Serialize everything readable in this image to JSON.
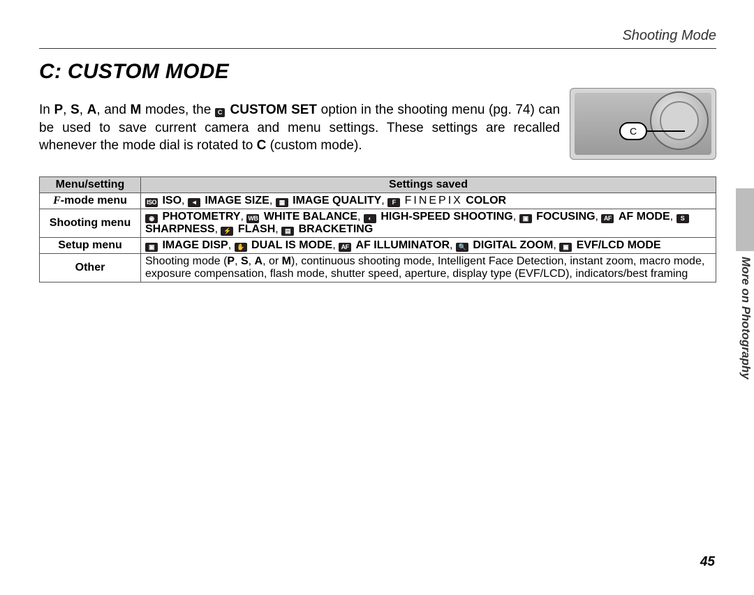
{
  "header": {
    "section": "Shooting Mode"
  },
  "title": "C: CUSTOM MODE",
  "intro": {
    "pre": "In ",
    "modes": [
      "P",
      "S",
      "A",
      "M"
    ],
    "mid": " modes, the ",
    "custom_set": "CUSTOM SET",
    "post1": " option in the shooting menu (pg. 74) can be used to save current camera and menu settings. These settings are recalled whenever the mode dial is rotated to ",
    "c_bold": "C",
    "post2": " (custom mode)."
  },
  "dial": {
    "callout": "C"
  },
  "table": {
    "head": {
      "col1": "Menu/setting",
      "col2": "Settings saved"
    },
    "rows": [
      {
        "label_prefix": "F",
        "label": "-mode menu",
        "items": [
          {
            "icon": "ISO",
            "text": "ISO"
          },
          {
            "icon": "SZ",
            "text": "IMAGE SIZE"
          },
          {
            "icon": "QL",
            "text": "IMAGE QUALITY"
          },
          {
            "icon": "FP",
            "text_prefix": "",
            "finepix": "FINEPIX",
            "text": " COLOR"
          }
        ]
      },
      {
        "label": "Shooting menu",
        "items": [
          {
            "icon": "PH",
            "text": "PHOTOMETRY"
          },
          {
            "icon": "WB",
            "text": "WHITE BALANCE"
          },
          {
            "icon": "HS",
            "text": "HIGH-SPEED SHOOTING"
          },
          {
            "icon": "FC",
            "text": "FOCUSING"
          },
          {
            "icon": "AF",
            "text": "AF MODE"
          },
          {
            "icon": "SH",
            "text": "SHARPNESS"
          },
          {
            "icon": "FL",
            "text": "FLASH"
          },
          {
            "icon": "BK",
            "text": "BRACKETING"
          }
        ]
      },
      {
        "label": "Setup menu",
        "items": [
          {
            "icon": "ID",
            "text": "IMAGE DISP"
          },
          {
            "icon": "IS",
            "text": "DUAL IS MODE"
          },
          {
            "icon": "AI",
            "text": "AF ILLUMINATOR"
          },
          {
            "icon": "DZ",
            "text": "DIGITAL ZOOM"
          },
          {
            "icon": "EL",
            "text": "EVF/LCD MODE"
          }
        ]
      },
      {
        "label": "Other",
        "plain": "Shooting mode (P, S, A, or M), continuous shooting mode, Intelligent Face Detection, instant zoom, macro mode, exposure compensation, flash mode, shutter speed, aperture, display type (EVF/LCD), indicators/best framing",
        "plain_bold_letters": [
          "P",
          "S",
          "A",
          "M"
        ]
      }
    ]
  },
  "side": {
    "tab_label": "More on Photography"
  },
  "page_number": "45"
}
